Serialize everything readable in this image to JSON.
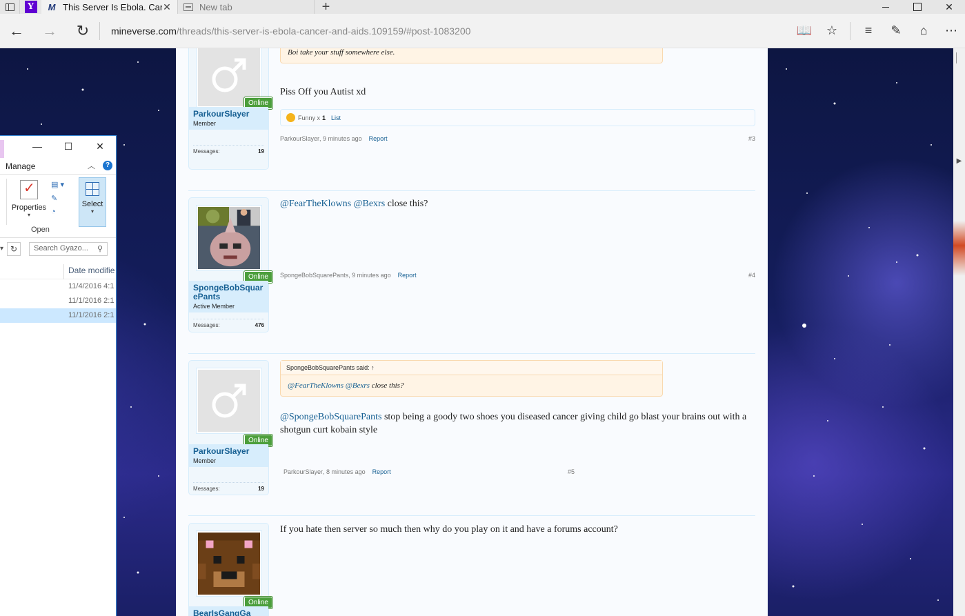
{
  "browser": {
    "tabs": [
      {
        "title": "This Server Is Ebola. Car",
        "active": true
      },
      {
        "title": "New tab",
        "active": false
      }
    ],
    "pinned_icon": "Y",
    "address": {
      "host": "mineverse.com",
      "path": "/threads/this-server-is-ebola-cancer-and-aids.109159/#post-1083200"
    }
  },
  "posts": [
    {
      "user": "ParkourSlayer",
      "role": "Member",
      "messages_label": "Messages:",
      "messages": "19",
      "online": "Online",
      "avatar": "male-symbol",
      "quote": {
        "author": "",
        "text": "Boi take your stuff somewhere else."
      },
      "text": "Piss Off you Autist xd",
      "likes": {
        "label": "Funny x",
        "count": "1",
        "list": "List"
      },
      "meta": {
        "author": "ParkourSlayer",
        "time": "9 minutes ago",
        "report": "Report",
        "number": "#3"
      }
    },
    {
      "user": "SpongeBobSquarePants",
      "role": "Active Member",
      "messages_label": "Messages:",
      "messages": "476",
      "online": "Online",
      "avatar": "photo-collage",
      "mention1": "@FearTheKlowns",
      "mention2": "@Bexrs",
      "text": "close this?",
      "meta": {
        "author": "SpongeBobSquarePants",
        "time": "9 minutes ago",
        "report": "Report",
        "number": "#4"
      }
    },
    {
      "user": "ParkourSlayer",
      "role": "Member",
      "messages_label": "Messages:",
      "messages": "19",
      "online": "Online",
      "avatar": "male-symbol",
      "quote": {
        "author": "SpongeBobSquarePants said: ↑",
        "mention1": "@FearTheKlowns",
        "mention2": "@Bexrs",
        "text": "close this?"
      },
      "mention": "@SpongeBobSquarePants",
      "text": "stop being a goody two shoes you diseased cancer giving child go blast your brains out with a shotgun curt kobain style",
      "meta": {
        "author": "ParkourSlayer",
        "time": "8 minutes ago",
        "report": "Report",
        "number": "#5"
      }
    },
    {
      "user": "BearIsGangGa",
      "online": "Online",
      "avatar": "bear-face",
      "text": "If you hate then server so much then why do you play on it and have a forums account?"
    }
  ],
  "explorer": {
    "ribbon_tab": "Manage",
    "properties": "Properties",
    "open": "Open",
    "select": "Select",
    "search_placeholder": "Search Gyazo...",
    "column": "Date modifie",
    "rows": [
      "11/4/2016 4:1",
      "11/1/2016 2:1",
      "11/1/2016 2:1"
    ]
  }
}
